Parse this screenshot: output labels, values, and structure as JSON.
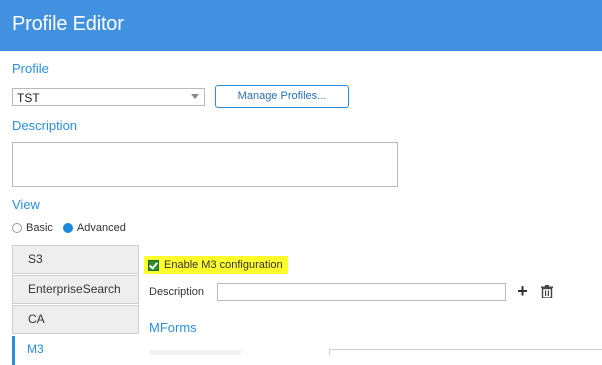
{
  "header": {
    "title": "Profile Editor",
    "bg_color": "#4191e0"
  },
  "profile": {
    "label": "Profile",
    "selected": "TST",
    "manage_button": "Manage Profiles..."
  },
  "description": {
    "label": "Description",
    "value": ""
  },
  "view": {
    "label": "View",
    "options": [
      {
        "label": "Basic",
        "selected": false
      },
      {
        "label": "Advanced",
        "selected": true
      }
    ]
  },
  "tabs": [
    {
      "label": "S3",
      "active": false
    },
    {
      "label": "EnterpriseSearch",
      "active": false
    },
    {
      "label": "CA",
      "active": false
    },
    {
      "label": "M3",
      "active": true
    }
  ],
  "m3": {
    "enable_label": "Enable M3 configuration",
    "enabled": true,
    "highlight_color": "#ffff2e",
    "description_label": "Description",
    "description_value": "",
    "add_icon": "plus-icon",
    "delete_icon": "trash-icon",
    "mforms_label": "MForms"
  },
  "accent_color": "#2b8fde"
}
